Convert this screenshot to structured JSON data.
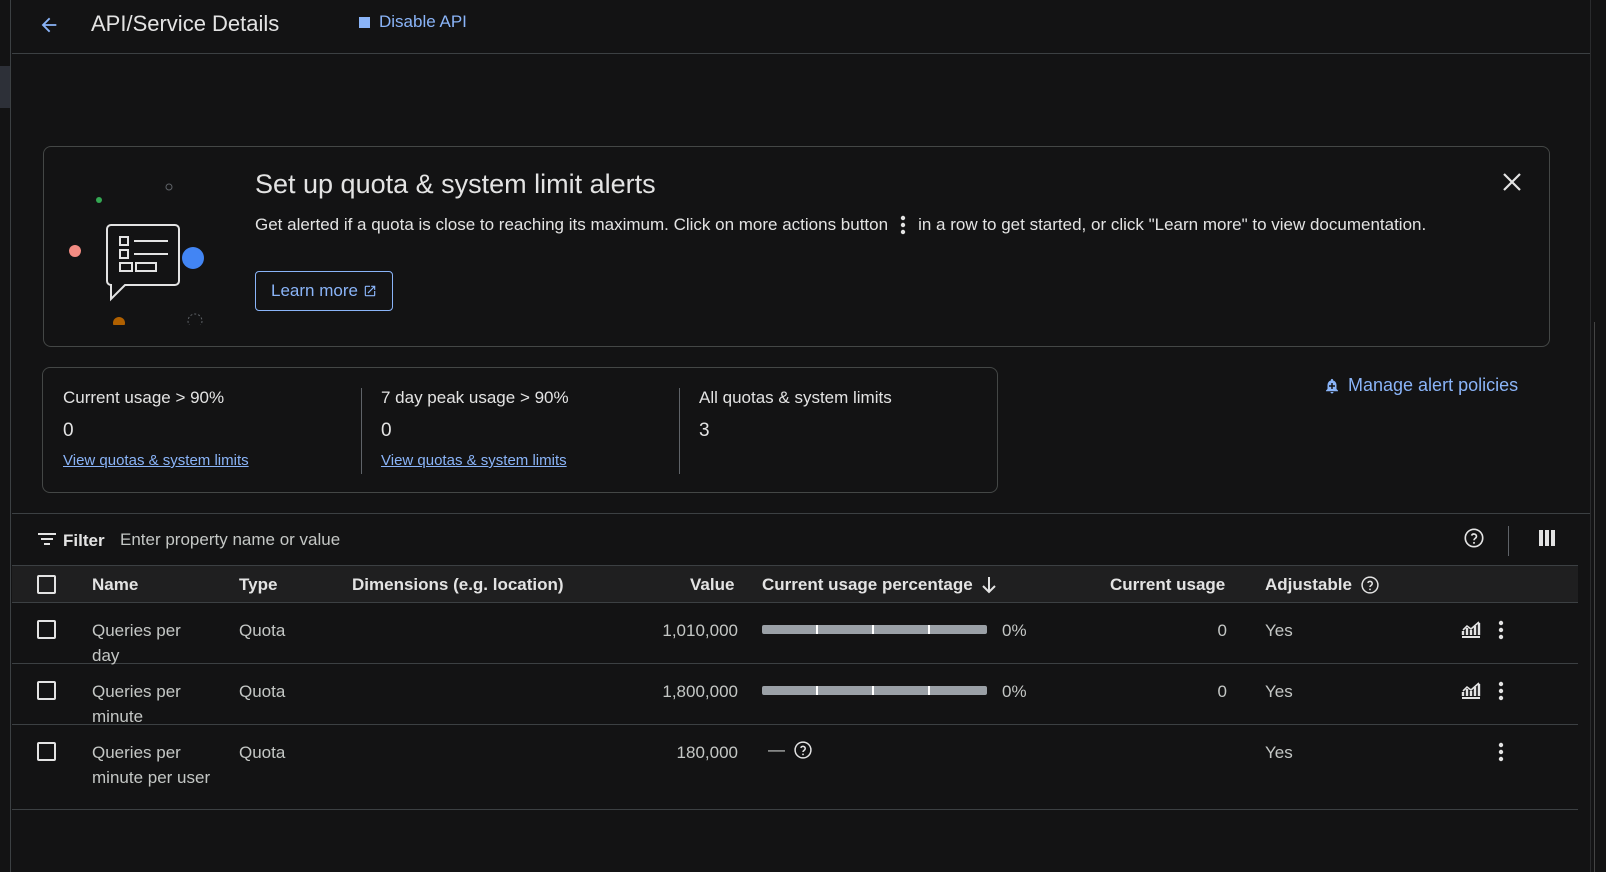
{
  "header": {
    "title": "API/Service Details",
    "disable_label": "Disable API"
  },
  "banner": {
    "title": "Set up quota & system limit alerts",
    "text_before": "Get alerted if a quota is close to reaching its maximum. Click on more actions button",
    "text_after": "in a row to get started, or click \"Learn more\" to view documentation.",
    "learn_more_label": "Learn more"
  },
  "stats": [
    {
      "label": "Current usage > 90%",
      "value": "0",
      "link": "View quotas & system limits"
    },
    {
      "label": "7 day peak usage > 90%",
      "value": "0",
      "link": "View quotas & system limits"
    },
    {
      "label": "All quotas & system limits",
      "value": "3",
      "link": ""
    }
  ],
  "manage_alerts_label": "Manage alert policies",
  "filter": {
    "label": "Filter",
    "placeholder": "Enter property name or value"
  },
  "table": {
    "columns": {
      "name": "Name",
      "type": "Type",
      "dimensions": "Dimensions (e.g. location)",
      "value": "Value",
      "usage_pct": "Current usage percentage",
      "usage": "Current usage",
      "adjustable": "Adjustable"
    },
    "rows": [
      {
        "name": "Queries per day",
        "type": "Quota",
        "value": "1,010,000",
        "usage_pct": "0%",
        "usage_fraction": 0,
        "usage": "0",
        "adjustable": "Yes"
      },
      {
        "name": "Queries per minute",
        "type": "Quota",
        "value": "1,800,000",
        "usage_pct": "0%",
        "usage_fraction": 0,
        "usage": "0",
        "adjustable": "Yes"
      },
      {
        "name": "Queries per minute per user",
        "type": "Quota",
        "value": "180,000",
        "usage_pct": "—",
        "usage": "",
        "adjustable": "Yes"
      }
    ]
  },
  "colors": {
    "background": "#131314",
    "accent": "#8ab4f8",
    "text": "#e3e3e3",
    "border": "#444746"
  },
  "icons": {
    "back": "arrow-back-icon",
    "disable": "stop-square-icon",
    "close": "close-icon",
    "external": "open-in-new-icon",
    "bell": "alert-bell-icon",
    "filter": "filter-list-icon",
    "help": "help-circle-icon",
    "columns": "view-column-icon",
    "sort": "arrow-down-icon",
    "chart": "monitoring-chart-icon",
    "more": "more-vert-icon"
  }
}
